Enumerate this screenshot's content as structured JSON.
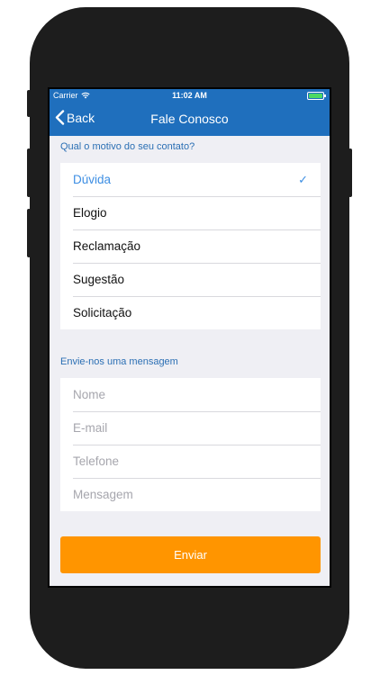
{
  "status": {
    "carrier": "Carrier",
    "time": "11:02 AM",
    "wifi_icon": "wifi-icon",
    "battery_icon": "battery-icon"
  },
  "nav": {
    "back_label": "Back",
    "title": "Fale Conosco"
  },
  "reason": {
    "label": "Qual o motivo do seu contato?",
    "options": [
      {
        "label": "Dúvida",
        "selected": true
      },
      {
        "label": "Elogio",
        "selected": false
      },
      {
        "label": "Reclamação",
        "selected": false
      },
      {
        "label": "Sugestão",
        "selected": false
      },
      {
        "label": "Solicitação",
        "selected": false
      }
    ],
    "check_mark": "✓"
  },
  "message": {
    "label": "Envie-nos uma mensagem",
    "fields": [
      {
        "placeholder": "Nome",
        "value": ""
      },
      {
        "placeholder": "E-mail",
        "value": ""
      },
      {
        "placeholder": "Telefone",
        "value": ""
      },
      {
        "placeholder": "Mensagem",
        "value": ""
      }
    ]
  },
  "submit": {
    "label": "Enviar"
  },
  "colors": {
    "nav_bg": "#1f6fbd",
    "accent": "#3d8ee3",
    "button": "#ff9500",
    "background": "#efeff4"
  }
}
